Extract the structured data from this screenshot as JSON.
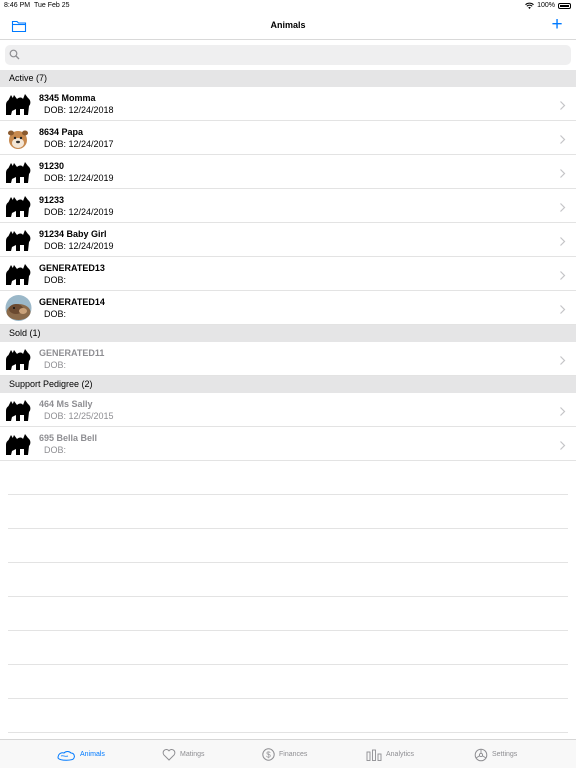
{
  "status": {
    "time": "8:46 PM",
    "date": "Tue Feb 25",
    "battery": "100%"
  },
  "nav": {
    "title": "Animals",
    "add_label": "+"
  },
  "search": {
    "placeholder": ""
  },
  "sections": [
    {
      "header": "Active (7)",
      "rows": [
        {
          "name": "8345 Momma",
          "dob": "DOB: 12/24/2018",
          "avatar": "silhouette"
        },
        {
          "name": "8634 Papa",
          "dob": "DOB: 12/24/2017",
          "avatar": "bulldog-photo"
        },
        {
          "name": "91230",
          "dob": "DOB: 12/24/2019",
          "avatar": "silhouette"
        },
        {
          "name": "91233",
          "dob": "DOB: 12/24/2019",
          "avatar": "silhouette"
        },
        {
          "name": "91234 Baby Girl",
          "dob": "DOB: 12/24/2019",
          "avatar": "silhouette"
        },
        {
          "name": "GENERATED13",
          "dob": "DOB:",
          "avatar": "silhouette"
        },
        {
          "name": "GENERATED14",
          "dob": "DOB:",
          "avatar": "dog-photo"
        }
      ]
    },
    {
      "header": "Sold (1)",
      "rows": [
        {
          "name": "GENERATED11",
          "dob": "DOB:",
          "avatar": "silhouette"
        }
      ]
    },
    {
      "header": "Support Pedigree (2)",
      "rows": [
        {
          "name": "464 Ms Sally",
          "dob": "DOB: 12/25/2015",
          "avatar": "silhouette"
        },
        {
          "name": "695 Bella Bell",
          "dob": "DOB:",
          "avatar": "silhouette"
        }
      ]
    }
  ],
  "tabs": [
    {
      "label": "Animals",
      "icon": "animals-icon",
      "active": true
    },
    {
      "label": "Matings",
      "icon": "heart-icon",
      "active": false
    },
    {
      "label": "Finances",
      "icon": "dollar-icon",
      "active": false
    },
    {
      "label": "Analytics",
      "icon": "bar-chart-icon",
      "active": false
    },
    {
      "label": "Settings",
      "icon": "gear-icon",
      "active": false
    }
  ],
  "colors": {
    "accent": "#007aff",
    "dimmed_text": "#8e8e92",
    "section_bg": "#e5e5e6"
  }
}
